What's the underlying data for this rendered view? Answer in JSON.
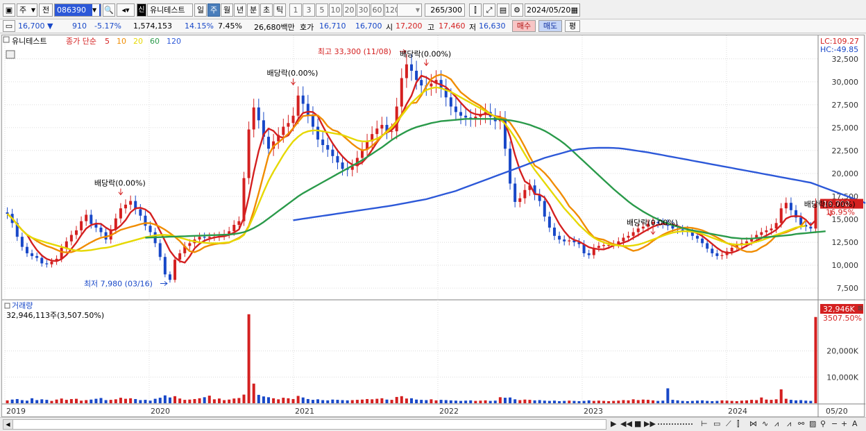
{
  "toolbar": {
    "market": "주",
    "prev_label": "전",
    "code": "086390",
    "stock_name": "유니테스트",
    "badge": "신",
    "periods": [
      "일",
      "주",
      "월",
      "년",
      "분",
      "초",
      "틱"
    ],
    "selected_period": "주",
    "intervals": [
      "1",
      "3",
      "5",
      "10",
      "20",
      "30",
      "60",
      "120"
    ],
    "count": "265",
    "count_total": "/300",
    "date": "2024/05/20"
  },
  "info": {
    "price": "16,700",
    "change": "910",
    "change_pct": "-5.17%",
    "volume": "1,574,153",
    "turnover_pct": "14.15%",
    "ratio": "7.45%",
    "amount": "26,680백만",
    "quote_label": "호가",
    "ask": "16,710",
    "bid": "16,700",
    "open_label": "시",
    "open": "17,200",
    "high_label": "고",
    "high": "17,460",
    "low_label": "저",
    "low": "16,630",
    "buy_label": "매수",
    "sell_label": "매도",
    "avg_label": "평"
  },
  "legend": {
    "name": "유니테스트",
    "type": "종가 단순",
    "ma": [
      {
        "period": "5",
        "color": "#d42020"
      },
      {
        "period": "10",
        "color": "#f08c00"
      },
      {
        "period": "20",
        "color": "#e6d800"
      },
      {
        "period": "60",
        "color": "#2a9a4a"
      },
      {
        "period": "120",
        "color": "#2c58d8"
      }
    ]
  },
  "scale": {
    "lc": "LC:109.27",
    "hc": "HC:-49.85",
    "price_tag": "16,700",
    "price_pct": "16.95%",
    "vol_tag": "32,946K",
    "vol_pct": "3507.50%"
  },
  "annotations": {
    "high": "최고 33,300 (11/08)",
    "low": "최저 7,980 (03/16)",
    "div1": "배당락(0.00%)",
    "div2": "배당락(0.00%)",
    "div3": "배당락(0.00%)",
    "div4": "배당락(0.00%)",
    "div5": "배당락(0.00%)"
  },
  "volume_pane": {
    "title": "거래량",
    "info": "32,946,113주(3,507.50%)"
  },
  "colors": {
    "up": "#d42020",
    "down": "#1848c8",
    "grid": "#dcdcdc",
    "price_tag_bg": "#d42020"
  },
  "chart_data": {
    "type": "candlestick",
    "price_axis": {
      "ylim": [
        6300,
        34300
      ],
      "ticks": [
        "7,500",
        "10,000",
        "12,500",
        "15,000",
        "17,500",
        "20,000",
        "22,500",
        "25,000",
        "27,500",
        "30,000",
        "32,500"
      ]
    },
    "volume_axis": {
      "ylim": [
        0,
        35000
      ],
      "ticks": [
        "10,000K",
        "20,000K"
      ]
    },
    "x_ticks": [
      "2019",
      "2020",
      "2021",
      "2022",
      "2023",
      "2024",
      "05/20"
    ],
    "close": [
      15600,
      14600,
      13100,
      12000,
      11300,
      11000,
      10800,
      10200,
      10100,
      10400,
      10700,
      11900,
      12600,
      13300,
      13800,
      14800,
      15500,
      14500,
      14100,
      13600,
      12800,
      13900,
      15100,
      16200,
      16600,
      17000,
      16100,
      15400,
      14300,
      13600,
      12400,
      10900,
      9000,
      8400,
      10600,
      11300,
      12100,
      12400,
      12800,
      13100,
      13000,
      13100,
      13100,
      13200,
      13400,
      13700,
      14400,
      14800,
      19500,
      24800,
      27200,
      25800,
      24000,
      22700,
      23500,
      24200,
      25100,
      25500,
      26300,
      28500,
      27600,
      26400,
      25100,
      23700,
      23100,
      22600,
      21900,
      21200,
      20500,
      20400,
      20800,
      21700,
      22600,
      23500,
      24300,
      24900,
      25300,
      24600,
      24600,
      27300,
      30400,
      31900,
      31200,
      30200,
      29600,
      29500,
      29800,
      30200,
      29300,
      28300,
      27300,
      26700,
      26300,
      26100,
      26000,
      26200,
      26400,
      26700,
      26200,
      25700,
      25900,
      22700,
      18900,
      16900,
      17300,
      18200,
      18700,
      17700,
      17000,
      15300,
      14100,
      13200,
      12800,
      12600,
      12700,
      12500,
      12300,
      11300,
      11100,
      11900,
      12100,
      12200,
      12200,
      12300,
      12600,
      13000,
      13200,
      13600,
      14000,
      14200,
      14500,
      14700,
      14600,
      14500,
      14300,
      14000,
      13900,
      13800,
      13600,
      13200,
      12900,
      12400,
      11800,
      11300,
      11000,
      11100,
      11500,
      11900,
      12200,
      12400,
      12600,
      12900,
      13300,
      13600,
      13800,
      14000,
      14600,
      16200,
      16800,
      16000,
      15200,
      14400,
      14200,
      14000,
      16700
    ],
    "ma": {
      "5": [
        15600,
        15100,
        14433,
        13825,
        13320,
        12400,
        11640,
        11060,
        10680,
        10500,
        10440,
        10660,
        11120,
        11780,
        12460,
        13280,
        14000,
        14380,
        14540,
        14500,
        14100,
        13780,
        13900,
        14320,
        14920,
        15760,
        16200,
        16260,
        16080,
        15680,
        14760,
        13720,
        12640,
        11560,
        10860,
        10440,
        10280,
        10960,
        11840,
        12340,
        12680,
        12880,
        13020,
        13100,
        13160,
        13300,
        13560,
        13900,
        15160,
        17440,
        20120,
        22460,
        24260,
        24900,
        24640,
        24040,
        23900,
        24160,
        24920,
        25920,
        26600,
        26740,
        26700,
        26260,
        25180,
        24180,
        23280,
        22500,
        21860,
        21320,
        20960,
        20920,
        21200,
        21800,
        22580,
        23400,
        24120,
        24460,
        24740,
        25340,
        26440,
        27560,
        28480,
        29940,
        30660,
        30480,
        30140,
        29860,
        29680,
        29420,
        28920,
        28360,
        27720,
        27140,
        26680,
        26460,
        26400,
        26480,
        26420,
        26240,
        26180,
        25440,
        24000,
        22020,
        20340,
        19140,
        18800,
        17760,
        17700,
        17380,
        16560,
        15460,
        14480,
        13700,
        13080,
        12760,
        12580,
        12280,
        11960,
        11820,
        11740,
        11720,
        11900,
        12140,
        12280,
        12460,
        12660,
        12980,
        13280,
        13600,
        13900,
        14200,
        14400,
        14500,
        14520,
        14420,
        14260,
        14060,
        13920,
        13700,
        13480,
        13180,
        12760,
        12320,
        11880,
        11520,
        11340,
        11360,
        11560,
        11820,
        12120,
        12400,
        12680,
        12960,
        13240,
        13520,
        13860,
        14400,
        15080,
        15320,
        15360,
        15320,
        14960,
        14360,
        14900
      ],
      "10": [
        15600,
        15100,
        14433,
        13825,
        13320,
        13000,
        12629,
        12325,
        12078,
        11910,
        11684,
        11448,
        11390,
        11424,
        11598,
        11878,
        12206,
        12506,
        12778,
        13000,
        13102,
        13244,
        13568,
        13850,
        14008,
        14168,
        14310,
        14470,
        14584,
        14590,
        14430,
        14180,
        13870,
        13490,
        13090,
        12630,
        12032,
        11530,
        11414,
        11640,
        11975,
        12154,
        12278,
        12370,
        12395,
        12460,
        12726,
        12982,
        13350,
        14300,
        15950,
        17860,
        19900,
        21980,
        22970,
        23390,
        23850,
        24330,
        24920,
        25620,
        26260,
        26330,
        26350,
        26330,
        25860,
        25160,
        24740,
        24580,
        24160,
        23690,
        23210,
        22810,
        22520,
        22620,
        23020,
        23520,
        24050,
        24620,
        25120,
        25720,
        26430,
        27120,
        27670,
        27720,
        28510,
        29510,
        30300,
        30640,
        30800,
        30600,
        30270,
        29550,
        28860,
        28440,
        28010,
        27690,
        27380,
        26920,
        26500,
        26200,
        26110,
        25980,
        25530,
        24740,
        23880,
        22890,
        21820,
        20870,
        20540,
        20050,
        19450,
        18730,
        18050,
        17290,
        16420,
        15870,
        15230,
        14420,
        13640,
        13060,
        12880,
        12780,
        12520,
        12290,
        12180,
        12070,
        11790,
        11560,
        11670,
        11930,
        12240,
        12650,
        13010,
        13320,
        13580,
        13770,
        13920,
        14080,
        14110,
        14060,
        13950,
        13800,
        13570,
        13290,
        13030,
        12730,
        12410,
        12200,
        11950,
        11660,
        11470,
        11450,
        11600,
        11950,
        12230,
        12690,
        13240,
        13440,
        13580,
        13810,
        14020,
        14280,
        14900
      ],
      "20": [
        15600,
        15100,
        14433,
        13825,
        13320,
        13000,
        12800,
        12625,
        12450,
        12300,
        12150,
        12000,
        11850,
        11700,
        11600,
        11550,
        11600,
        11650,
        11750,
        11850,
        11900,
        12000,
        12150,
        12300,
        12450,
        12600,
        12750,
        12900,
        13050,
        13150,
        13250,
        13300,
        13300,
        13250,
        13150,
        13000,
        12850,
        12700,
        12600,
        12500,
        12450,
        12400,
        12400,
        12400,
        12450,
        12500,
        12700,
        12900,
        13300,
        14200,
        15400,
        16700,
        18000,
        19200,
        20200,
        21100,
        22000,
        22800,
        23500,
        24000,
        24400,
        24600,
        24700,
        24700,
        24600,
        24500,
        24400,
        24300,
        24200,
        24000,
        23800,
        23600,
        23500,
        23500,
        23600,
        23800,
        24100,
        24500,
        25000,
        25600,
        26300,
        27000,
        27700,
        28200,
        28700,
        29100,
        29300,
        29400,
        29300,
        29100,
        28900,
        28600,
        28300,
        28000,
        27700,
        27400,
        27100,
        26800,
        26500,
        26200,
        25900,
        25400,
        24700,
        23900,
        23000,
        22100,
        21200,
        20400,
        19700,
        19000,
        18300,
        17600,
        16900,
        16200,
        15600,
        15000,
        14400,
        13900,
        13400,
        13000,
        12700,
        12500,
        12300,
        12200,
        12150,
        12100,
        12100,
        12150,
        12250,
        12400,
        12600,
        12800,
        13000,
        13200,
        13400,
        13550,
        13650,
        13700,
        13700,
        13650,
        13550,
        13400,
        13200,
        13000,
        12800,
        12600,
        12400,
        12300,
        12250,
        12250,
        12300,
        12400,
        12550,
        12700,
        12900,
        13100,
        13300,
        13500,
        13700,
        13900,
        14100,
        14200,
        14300
      ],
      "60": [
        null,
        null,
        null,
        null,
        null,
        null,
        null,
        null,
        null,
        null,
        null,
        null,
        null,
        null,
        null,
        null,
        null,
        null,
        null,
        null,
        null,
        null,
        null,
        null,
        null,
        null,
        null,
        null,
        13000,
        13020,
        13040,
        13060,
        13080,
        13100,
        13120,
        13140,
        13160,
        13180,
        13200,
        13220,
        13240,
        13260,
        13280,
        13300,
        13320,
        13340,
        13400,
        13480,
        13600,
        13800,
        14050,
        14350,
        14700,
        15100,
        15500,
        15900,
        16300,
        16700,
        17100,
        17500,
        17850,
        18150,
        18450,
        18750,
        19050,
        19350,
        19650,
        19950,
        20250,
        20550,
        20850,
        21150,
        21450,
        21800,
        22150,
        22500,
        22850,
        23250,
        23650,
        24000,
        24300,
        24600,
        24850,
        25050,
        25200,
        25350,
        25500,
        25600,
        25700,
        25750,
        25800,
        25850,
        25900,
        25950,
        25950,
        25950,
        25950,
        25950,
        25950,
        25950,
        25900,
        25850,
        25800,
        25700,
        25600,
        25450,
        25300,
        25100,
        24900,
        24650,
        24350,
        24000,
        23650,
        23250,
        22800,
        22300,
        21800,
        21300,
        20800,
        20300,
        19800,
        19300,
        18800,
        18300,
        17850,
        17400,
        16950,
        16550,
        16200,
        15850,
        15550,
        15250,
        15000,
        14750,
        14550,
        14350,
        14200,
        14050,
        13900,
        13800,
        13700,
        13600,
        13500,
        13400,
        13300,
        13200,
        13100,
        13000,
        12950,
        12900,
        12900,
        12900,
        12950,
        13000,
        13050,
        13100,
        13150,
        13200,
        13250,
        13300,
        13400,
        13450,
        13500,
        13550,
        13600,
        13650,
        13700
      ],
      "120": [
        null,
        null,
        null,
        null,
        null,
        null,
        null,
        null,
        null,
        null,
        null,
        null,
        null,
        null,
        null,
        null,
        null,
        null,
        null,
        null,
        null,
        null,
        null,
        null,
        null,
        null,
        null,
        null,
        null,
        null,
        null,
        null,
        null,
        null,
        null,
        null,
        null,
        null,
        null,
        null,
        null,
        null,
        null,
        null,
        null,
        null,
        null,
        null,
        null,
        null,
        null,
        null,
        null,
        null,
        null,
        null,
        null,
        null,
        14900,
        14980,
        15060,
        15140,
        15220,
        15300,
        15380,
        15460,
        15540,
        15620,
        15700,
        15780,
        15860,
        15940,
        16020,
        16100,
        16180,
        16260,
        16340,
        16420,
        16500,
        16600,
        16700,
        16800,
        16900,
        17000,
        17100,
        17200,
        17350,
        17500,
        17650,
        17800,
        17950,
        18100,
        18300,
        18500,
        18700,
        18900,
        19100,
        19300,
        19500,
        19700,
        19900,
        20100,
        20300,
        20500,
        20700,
        20900,
        21100,
        21300,
        21500,
        21700,
        21850,
        22000,
        22150,
        22300,
        22450,
        22550,
        22650,
        22700,
        22750,
        22780,
        22800,
        22800,
        22800,
        22780,
        22750,
        22700,
        22620,
        22540,
        22460,
        22380,
        22300,
        22200,
        22100,
        22000,
        21900,
        21800,
        21700,
        21600,
        21500,
        21400,
        21300,
        21200,
        21100,
        21000,
        20900,
        20800,
        20700,
        20600,
        20500,
        20400,
        20300,
        20200,
        20100,
        20000,
        19900,
        19800,
        19700,
        19600,
        19500,
        19400,
        19300,
        19200,
        19100,
        19000,
        18800,
        18600,
        18400,
        18200,
        18000,
        17800,
        17600,
        17400,
        17200,
        17000,
        16800,
        16600,
        16400,
        16200,
        16000
      ]
    },
    "volume": [
      1100,
      1400,
      1600,
      1200,
      1000,
      1900,
      1200,
      1500,
      1300,
      900,
      1400,
      1800,
      1300,
      1600,
      1700,
      1000,
      1200,
      1400,
      1700,
      2000,
      1200,
      1300,
      1500,
      2100,
      1700,
      1900,
      1600,
      1200,
      1300,
      1000,
      1700,
      2100,
      3000,
      2200,
      2700,
      1800,
      1300,
      1400,
      1600,
      1900,
      2300,
      2900,
      1500,
      1800,
      1200,
      1400,
      1800,
      2000,
      3300,
      34000,
      7500,
      3200,
      2600,
      2300,
      1900,
      1500,
      2100,
      1900,
      1600,
      2800,
      2200,
      1600,
      1300,
      1500,
      1200,
      1100,
      1400,
      1300,
      1200,
      1100,
      1200,
      1300,
      1400,
      1600,
      1500,
      1700,
      1900,
      1400,
      1300,
      2400,
      2700,
      1800,
      1900,
      1400,
      1300,
      1200,
      1500,
      1100,
      1300,
      1200,
      1100,
      1000,
      900,
      1000,
      1100,
      900,
      1000,
      1100,
      900,
      1000,
      2300,
      2100,
      2200,
      1500,
      1200,
      1400,
      1300,
      1100,
      1200,
      1000,
      900,
      1000,
      800,
      900,
      1000,
      900,
      800,
      900,
      1100,
      900,
      1000,
      900,
      800,
      900,
      1000,
      1200,
      1100,
      1500,
      1200,
      1400,
      1300,
      1100,
      900,
      1000,
      5700,
      1300,
      1100,
      900,
      800,
      900,
      1000,
      1100,
      900,
      800,
      900,
      1100,
      1000,
      900,
      800,
      1000,
      1100,
      1300,
      1200,
      2200,
      1400,
      1300,
      1500,
      5300,
      1700,
      1300,
      1100,
      1200,
      1000,
      900,
      32946
    ]
  }
}
